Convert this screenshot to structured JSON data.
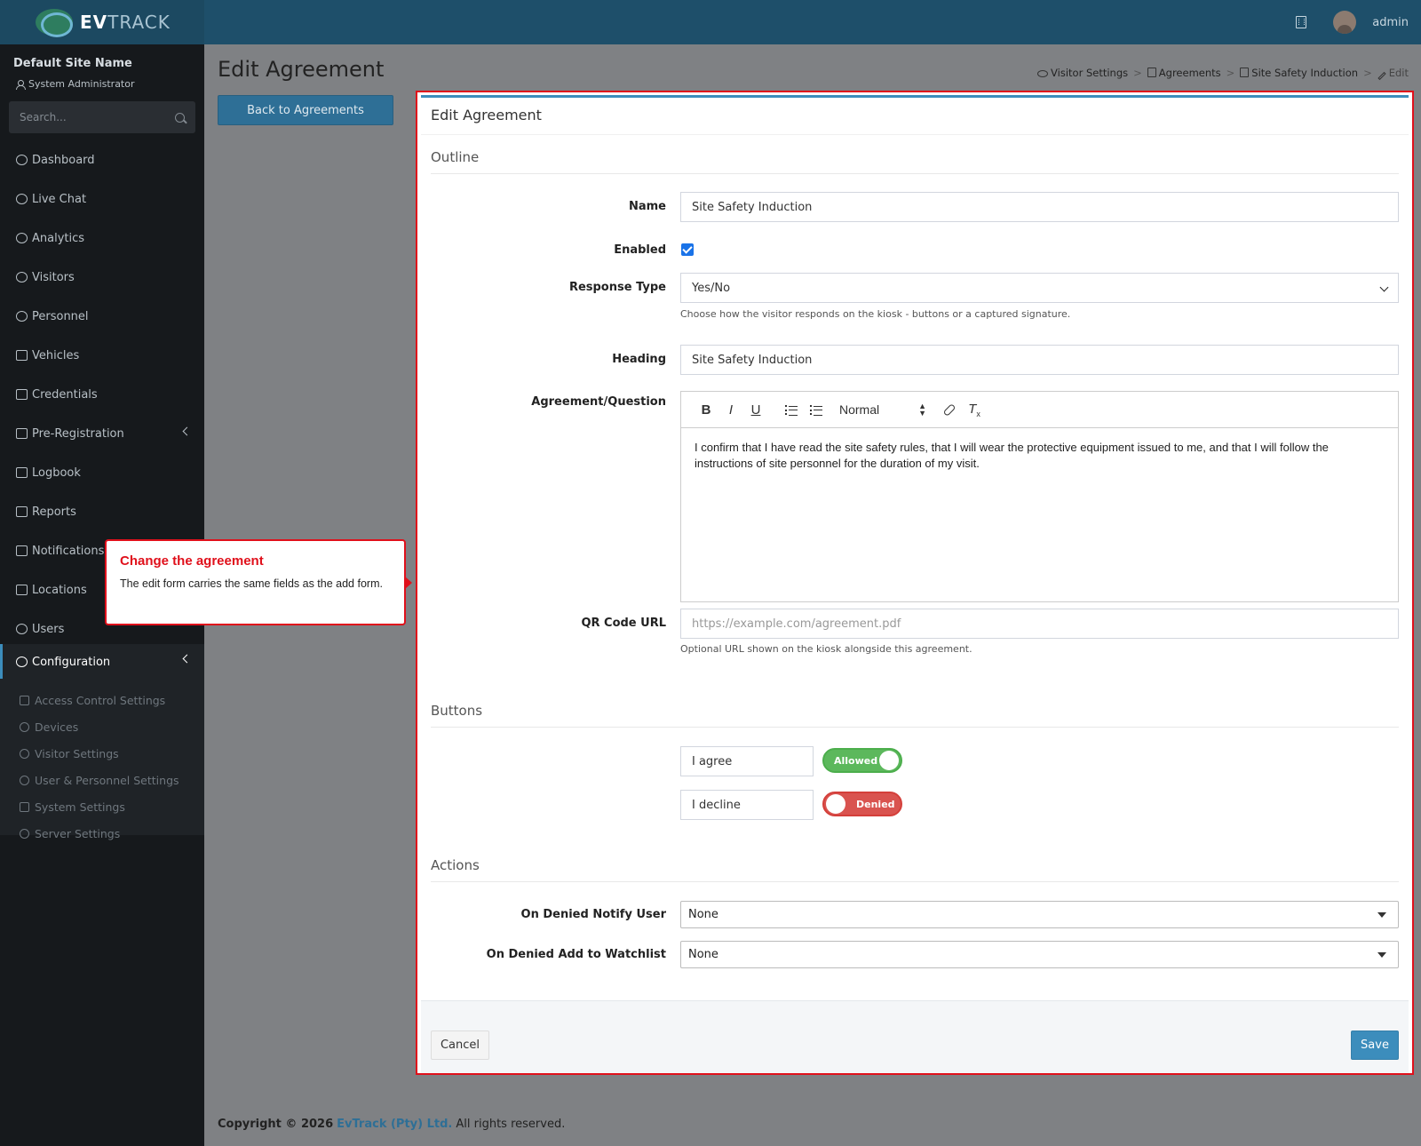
{
  "brand": {
    "name": "EVTRACK"
  },
  "topbar": {
    "user": "admin"
  },
  "sidebar": {
    "site_name": "Default Site Name",
    "role": "System Administrator",
    "search_placeholder": "Search...",
    "items": [
      {
        "label": "Dashboard",
        "icon": "gauge-icon"
      },
      {
        "label": "Live Chat",
        "icon": "headset-icon"
      },
      {
        "label": "Analytics",
        "icon": "target-icon"
      },
      {
        "label": "Visitors",
        "icon": "eye-icon"
      },
      {
        "label": "Personnel",
        "icon": "user-icon"
      },
      {
        "label": "Vehicles",
        "icon": "car-icon"
      },
      {
        "label": "Credentials",
        "icon": "id-card-icon"
      },
      {
        "label": "Pre-Registration",
        "icon": "arrows-icon"
      },
      {
        "label": "Logbook",
        "icon": "book-icon"
      },
      {
        "label": "Reports",
        "icon": "chart-icon"
      },
      {
        "label": "Notifications",
        "icon": "chat-icon"
      },
      {
        "label": "Locations",
        "icon": "map-icon"
      },
      {
        "label": "Users",
        "icon": "users-icon"
      },
      {
        "label": "Configuration",
        "icon": "cog-icon"
      }
    ],
    "config_sub": [
      {
        "label": "Access Control Settings",
        "icon": "lock-icon"
      },
      {
        "label": "Devices",
        "icon": "cog-icon"
      },
      {
        "label": "Visitor Settings",
        "icon": "eye-icon"
      },
      {
        "label": "User & Personnel Settings",
        "icon": "user-icon"
      },
      {
        "label": "System Settings",
        "icon": "sliders-icon"
      },
      {
        "label": "Server Settings",
        "icon": "server-icon"
      }
    ]
  },
  "page": {
    "title": "Edit Agreement",
    "back_label": "Back to Agreements",
    "breadcrumb": [
      "Visitor Settings",
      "Agreements",
      "Site Safety Induction",
      "Edit"
    ]
  },
  "card": {
    "title": "Edit Agreement",
    "sections": {
      "outline": "Outline",
      "buttons": "Buttons",
      "actions": "Actions"
    },
    "fields": {
      "name": {
        "label": "Name",
        "value": "Site Safety Induction"
      },
      "enabled": {
        "label": "Enabled",
        "checked": true
      },
      "response_type": {
        "label": "Response Type",
        "value": "Yes/No",
        "help": "Choose how the visitor responds on the kiosk - buttons or a captured signature."
      },
      "heading": {
        "label": "Heading",
        "value": "Site Safety Induction"
      },
      "agreement": {
        "label": "Agreement/Question",
        "format": "Normal",
        "text": "I confirm that I have read the site safety rules, that I will wear the protective equipment issued to me, and that I will follow the instructions of site personnel for the duration of my visit."
      },
      "qr_url": {
        "label": "QR Code URL",
        "placeholder": "https://example.com/agreement.pdf",
        "help": "Optional URL shown on the kiosk alongside this agreement."
      }
    },
    "buttons": [
      {
        "label": "I agree",
        "state": "Allowed"
      },
      {
        "label": "I decline",
        "state": "Denied"
      }
    ],
    "actions": {
      "notify_user": {
        "label": "On Denied Notify User",
        "value": "None"
      },
      "watchlist": {
        "label": "On Denied Add to Watchlist",
        "value": "None"
      }
    },
    "cancel_label": "Cancel",
    "save_label": "Save"
  },
  "callout": {
    "title": "Change the agreement",
    "body": "The edit form carries the same fields as the add form."
  },
  "footer": {
    "copyright": "Copyright © 2026",
    "company": "EvTrack (Pty) Ltd.",
    "rest": "All rights reserved."
  },
  "colors": {
    "accent": "#3c8dbc",
    "topbar": "#1e4f6a",
    "sidebar": "#16191c",
    "highlight": "#e0101b",
    "allowed": "#5cb85c",
    "denied": "#d9534f"
  }
}
